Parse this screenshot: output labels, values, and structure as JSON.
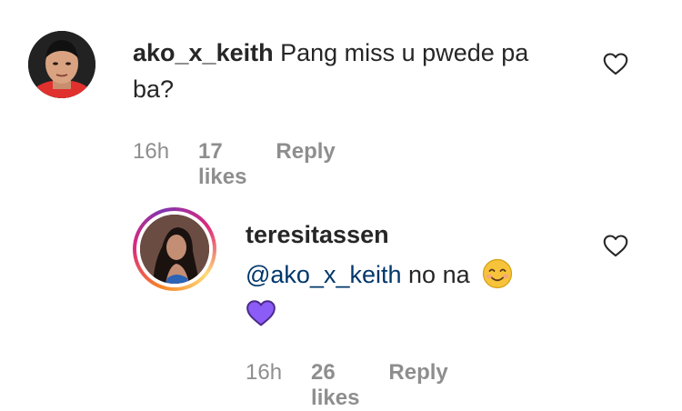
{
  "comments": [
    {
      "username": "ako_x_keith",
      "text": "Pang miss u pwede pa ba?",
      "time": "16h",
      "likes": "17 likes",
      "reply_label": "Reply",
      "avatar_icon": "user-avatar-icon",
      "like_icon": "heart-outline-icon"
    },
    {
      "username": "teresitassen",
      "mention": "@ako_x_keith",
      "text": "no na",
      "emojis": [
        "smiling-face-emoji",
        "purple-heart-emoji"
      ],
      "time": "16h",
      "likes": "26 likes",
      "reply_label": "Reply",
      "avatar_icon": "user-avatar-icon",
      "like_icon": "heart-outline-icon"
    }
  ],
  "colors": {
    "text": "#262626",
    "secondary": "#8e8e8e",
    "mention": "#00376b",
    "story_ring": "#dd2a7b",
    "purple_heart": "#8b5cf6",
    "emoji_yellow": "#f7c33b"
  }
}
